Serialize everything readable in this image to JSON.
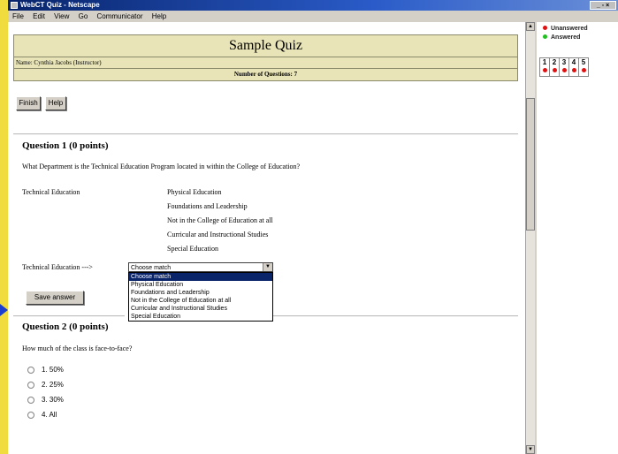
{
  "window": {
    "title": "WebCT Quiz - Netscape",
    "controls": "_ ▫ ×"
  },
  "menu": [
    "File",
    "Edit",
    "View",
    "Go",
    "Communicator",
    "Help"
  ],
  "quiz": {
    "title": "Sample Quiz",
    "name_label": "Name: Cynthia Jacobs (Instructor)",
    "num_questions": "Number of Questions: 7",
    "finish_label": "Finish",
    "help_label": "Help"
  },
  "question1": {
    "title": "Question 1  (0 points)",
    "text": "What Department is the Technical Education Program located in within the College of Education?",
    "left_item": "Technical Education",
    "choices": [
      "Physical Education",
      "Foundations and Leadership",
      "Not in the College of Education at all",
      "Curricular and Instructional Studies",
      "Special Education"
    ],
    "match_label": "Technical Education  --->",
    "select_value": "Choose match",
    "options": [
      "Choose match",
      "Physical Education",
      "Foundations and Leadership",
      "Not in the College of Education at all",
      "Curricular and Instructional Studies",
      "Special Education"
    ],
    "save_label": "Save answer"
  },
  "question2": {
    "title": "Question 2  (0 points)",
    "text": "How much of the class is face-to-face?",
    "options": [
      "1. 50%",
      "2. 25%",
      "3. 30%",
      "4. All"
    ]
  },
  "status": {
    "unanswered": "Unanswered",
    "answered": "Answered",
    "unanswered_color": "#e01010",
    "answered_color": "#20c020",
    "numbers": [
      "1",
      "2",
      "3",
      "4",
      "5"
    ]
  }
}
